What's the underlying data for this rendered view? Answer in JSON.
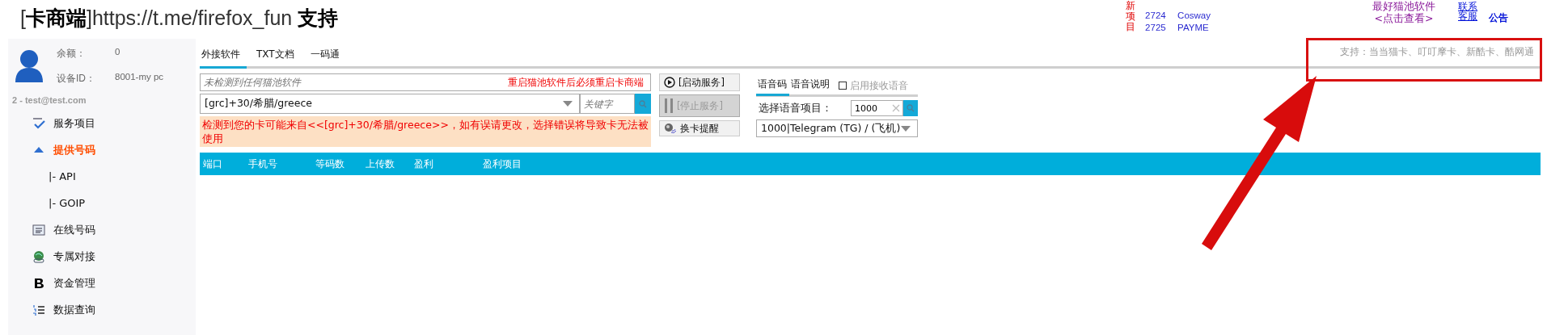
{
  "window": {
    "title": "[**卡商端**]https://t.me/firefox_fun **支持**"
  },
  "news": {
    "label": "新项目",
    "items": [
      {
        "code": "2724",
        "name": "Cosway"
      },
      {
        "code": "2725",
        "name": "PAYME"
      }
    ]
  },
  "promo": {
    "title": "最好猫池软件",
    "link": "<点击查看>"
  },
  "header_links": [
    {
      "label": "联系客服",
      "kind": "underlined"
    },
    {
      "label": "公告",
      "kind": "bold"
    }
  ],
  "account": {
    "balance_label": "余额：",
    "balance": "0",
    "device_label": "设备ID：",
    "device": "8001-my pc",
    "user": "2 - test@test.com"
  },
  "sidebar": {
    "items": [
      {
        "label": "服务项目",
        "selected": false
      },
      {
        "label": "提供号码",
        "selected": true,
        "children": [
          {
            "label": "|- API",
            "selected": false
          },
          {
            "label": "|- GOIP",
            "selected": false
          }
        ]
      },
      {
        "label": "在线号码",
        "selected": false
      },
      {
        "label": "专属对接",
        "selected": false
      },
      {
        "label": "资金管理",
        "selected": false
      },
      {
        "label": "数据查询",
        "selected": false
      }
    ]
  },
  "tabs": [
    {
      "label": "外接软件",
      "selected": true
    },
    {
      "label": "TXT文档",
      "selected": false
    },
    {
      "label": "一码通",
      "selected": false
    }
  ],
  "support_note": "支持：当当猫卡、叮叮摩卡、新酷卡、酷网通",
  "software_field": {
    "placeholder": "未检测到任何猫池软件",
    "notice": "重启猫池软件后必须重启卡商端"
  },
  "country_select": {
    "value": "[grc]+30/希腊/greece"
  },
  "keyword_field": {
    "placeholder": "关键字"
  },
  "warning": "检测到您的卡可能来自<<[grc]+30/希腊/greece>>，如有误请更改，选择错误将导致卡无法被使用",
  "service_buttons": [
    {
      "label": "[启动服务]",
      "kind": "start",
      "disabled": false
    },
    {
      "label": "[停止服务]",
      "kind": "stop",
      "disabled": true
    },
    {
      "label": "换卡提醒",
      "kind": "alert",
      "disabled": false
    }
  ],
  "voice": {
    "tabs": [
      {
        "label": "语音码",
        "selected": true
      },
      {
        "label": "语音说明",
        "selected": false
      }
    ],
    "receive_checkbox": {
      "label": "启用接收语音",
      "checked": false
    },
    "project_label": "选择语音项目：",
    "search_value": "1000",
    "project_select": "1000|Telegram (TG) / (飞机)"
  },
  "table": {
    "columns": [
      "端口",
      "手机号",
      "等码数",
      "上传数",
      "盈利",
      "盈利项目"
    ]
  }
}
